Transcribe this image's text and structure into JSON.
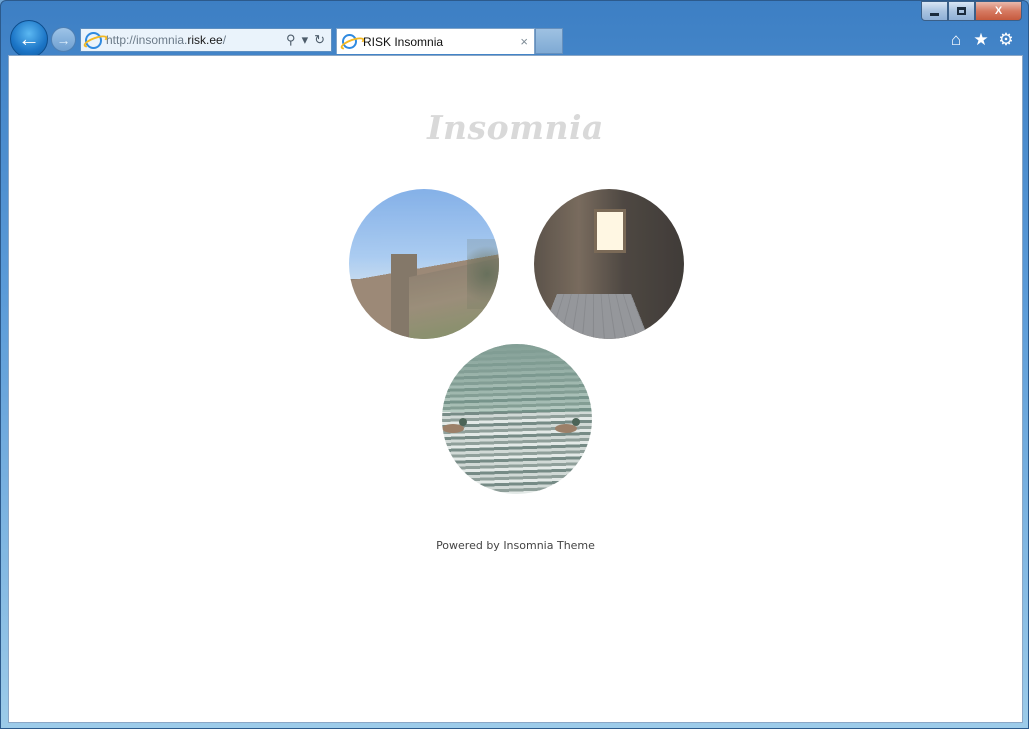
{
  "browser": {
    "address": {
      "prefix": "http://insomnia.",
      "domain": "risk.ee",
      "suffix": "/"
    },
    "tab": {
      "title": "RISK Insomnia",
      "close": "×"
    },
    "caption": {
      "close": "X"
    },
    "nav": {
      "back_glyph": "←",
      "forward_glyph": "→"
    },
    "address_icons": {
      "search": "⚲",
      "dropdown": "▾",
      "refresh": "↻"
    },
    "toolbar_icons": {
      "home": "⌂",
      "favorites": "★",
      "tools": "⚙"
    }
  },
  "page": {
    "site_title": "Insomnia",
    "footer": "Powered by Insomnia Theme"
  }
}
